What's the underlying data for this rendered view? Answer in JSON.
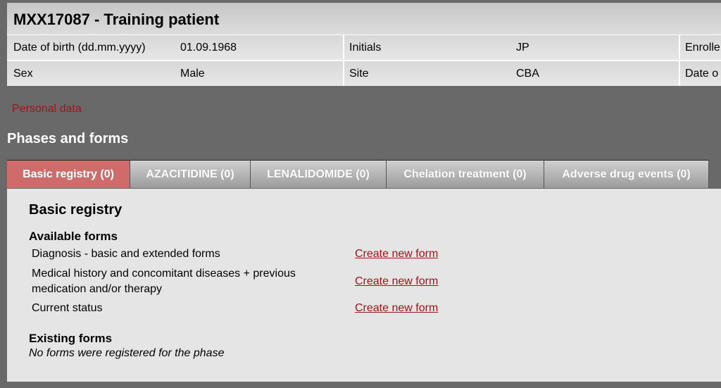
{
  "header": {
    "title": "MXX17087 - Training patient",
    "rows": [
      [
        {
          "label": "Date of birth (dd.mm.yyyy)",
          "value": "01.09.1968"
        },
        {
          "label": "Initials",
          "value": "JP"
        },
        {
          "label": "Enrolle"
        }
      ],
      [
        {
          "label": "Sex",
          "value": "Male"
        },
        {
          "label": "Site",
          "value": "CBA"
        },
        {
          "label": "Date o"
        }
      ]
    ]
  },
  "personal_data_link": "Personal data",
  "phases": {
    "title": "Phases and forms",
    "tabs": [
      {
        "label": "Basic registry (0)",
        "active": true
      },
      {
        "label": "AZACITIDINE (0)",
        "active": false
      },
      {
        "label": "LENALIDOMIDE (0)",
        "active": false
      },
      {
        "label": "Chelation treatment (0)",
        "active": false
      },
      {
        "label": "Adverse drug events (0)",
        "active": false
      }
    ],
    "active_color": "#cf6b6b"
  },
  "panel": {
    "title": "Basic registry",
    "available_heading": "Available forms",
    "forms": [
      {
        "name": "Diagnosis - basic and extended forms",
        "action": "Create new form"
      },
      {
        "name_line1": "Medical history and concomitant diseases + previous",
        "name_line2": "medication and/or therapy",
        "action": "Create new form"
      },
      {
        "name": "Current status",
        "action": "Create new form"
      }
    ],
    "existing_heading": "Existing forms",
    "existing_empty": "No forms were registered for the phase"
  }
}
